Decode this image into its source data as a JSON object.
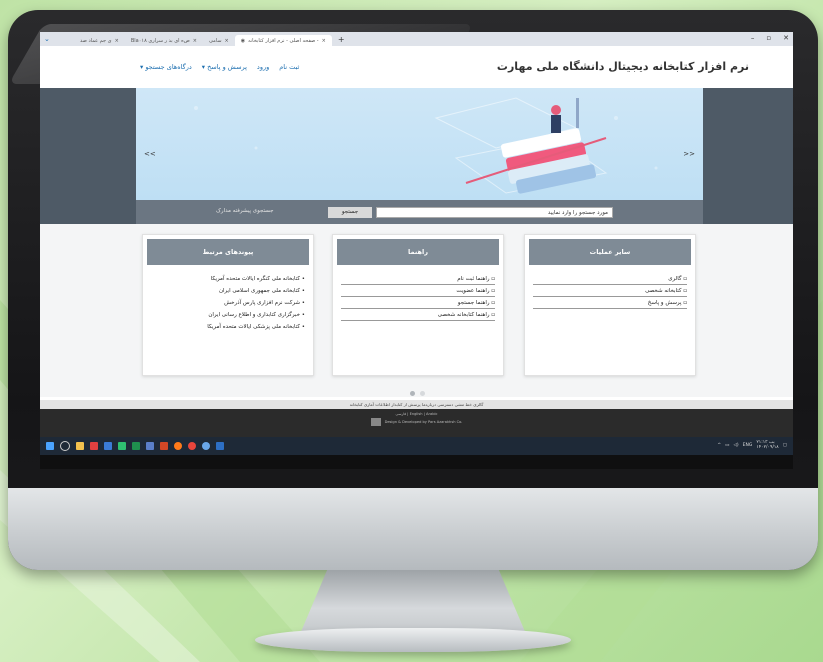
{
  "browser": {
    "tabs": [
      "ی‌ جم عماد صد",
      "Bla۰۱۸ ص‌‌ه ای بذ ر‌ سراری",
      "سامی",
      "صفحه اصلی - نرم افزار کتابخانه -"
    ],
    "active_tab_index": 3,
    "new_tab": "+",
    "win_controls": [
      "–",
      "▫",
      "✕"
    ]
  },
  "site": {
    "brand": "نرم افزار کتابخانه دیجیتال دانشگاه ملی مهارت",
    "nav": [
      "ثبت نام",
      "ورود",
      "پرسش و پاسخ ▾",
      "درگاه‌های جستجو ▾"
    ],
    "hero_prev": "<<",
    "hero_next": ">>"
  },
  "search": {
    "placeholder": "مورد جستجو را وارد نمایید",
    "button": "جستجو",
    "advanced": "جستجوی پیشرفته مدارک"
  },
  "cards": {
    "other": {
      "title": "سایر عملیات",
      "items": [
        "گالری",
        "کتابخانه شخصی",
        "پرسش و پاسخ"
      ]
    },
    "guide": {
      "title": "راهنما",
      "items": [
        "راهنما ثبت نام",
        "راهنما عضویت",
        "راهنما جستجو",
        "راهنما کتابخانه شخصی"
      ]
    },
    "links": {
      "title": "پیوندهای مرتبط",
      "items": [
        "کتابخانه ملی کنگره ایالات متحده آمریکا",
        "کتابخانه ملی جمهوری اسلامی ایران",
        "شرکت نرم افزاری پارس آذرخش",
        "خبرگزاری کتابداری و اطلاع رسانی ایران",
        "کتابخانه ملی پزشکی ایالات متحده آمریکا"
      ]
    }
  },
  "footer": {
    "links": "گالری   خط مشی دسترسی   درباره‌ما   پرسش از کتابدار   اطلاعات آماری کتابخانه",
    "lang": "فارسی | English | Arabic",
    "credit": "Design & Developed by Pars Azarakhsh Co."
  },
  "taskbar": {
    "lang": "ENG",
    "time": "۲۱:۱۳ بب",
    "date": "۱۴۰۲/۰۹/۱۸"
  },
  "colors": {
    "heroband": "#4e5a66",
    "card_header": "#7f8b96",
    "link": "#1d6fb0"
  }
}
